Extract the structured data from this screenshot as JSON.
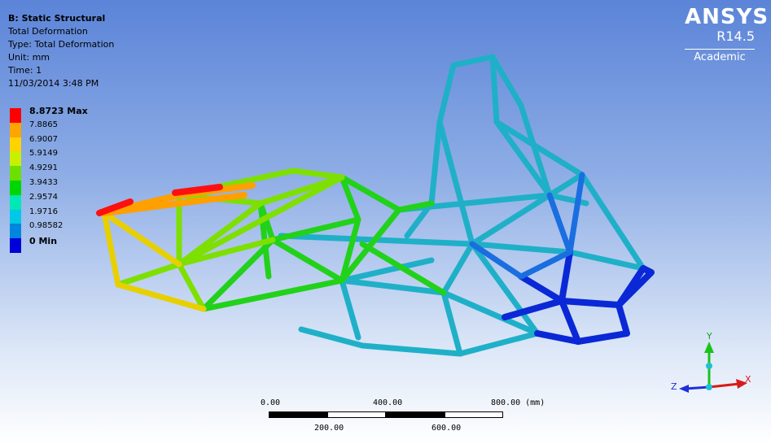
{
  "info": {
    "title": "B: Static Structural",
    "result": "Total Deformation",
    "type": "Type: Total Deformation",
    "unit": "Unit: mm",
    "time": "Time: 1",
    "date": "11/03/2014 3:48 PM"
  },
  "legend": [
    {
      "label": "8.8723 Max",
      "color": "#ff0000",
      "bold": true
    },
    {
      "label": "7.8865",
      "color": "#ffa500"
    },
    {
      "label": "6.9007",
      "color": "#ffd200"
    },
    {
      "label": "5.9149",
      "color": "#c8f000"
    },
    {
      "label": "4.9291",
      "color": "#6ce000"
    },
    {
      "label": "3.9433",
      "color": "#00d600"
    },
    {
      "label": "2.9574",
      "color": "#00e8b4"
    },
    {
      "label": "1.9716",
      "color": "#00c8e6"
    },
    {
      "label": "0.98582",
      "color": "#0086dc"
    },
    {
      "label": "0 Min",
      "color": "#0000d8",
      "bold": true
    }
  ],
  "logo": {
    "brand": "ANSYS",
    "version": "R14.5",
    "edition": "Academic"
  },
  "triad": {
    "y": "Y",
    "z": "Z",
    "x": "X"
  },
  "scale": {
    "top_start": "0.00",
    "top_mid": "400.00",
    "top_end": "800.00 (mm)",
    "bottom_1": "200.00",
    "bottom_2": "600.00"
  }
}
